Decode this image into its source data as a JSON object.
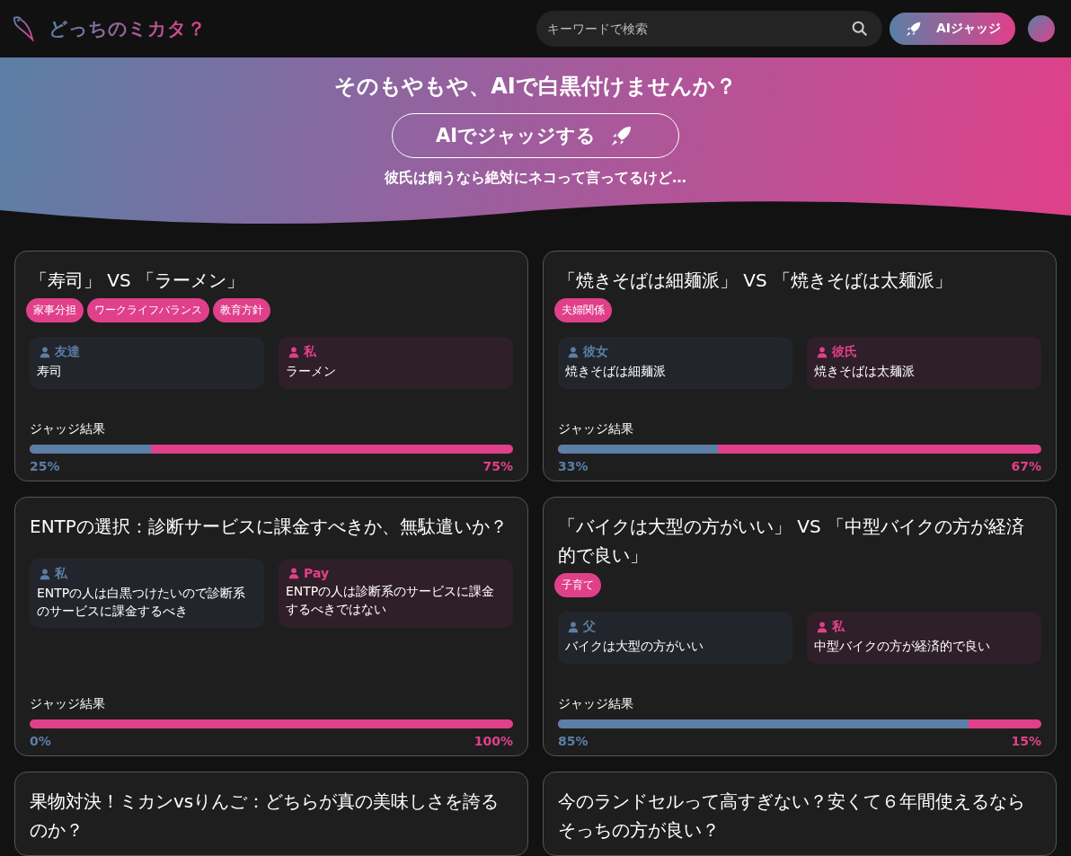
{
  "header": {
    "logo_text": "どっちのミカタ？",
    "search": {
      "placeholder": "キーワードで検索"
    },
    "ai_button": "AIジャッジ"
  },
  "hero": {
    "heading": "そのもやもや、AIで白黒付けませんか？",
    "cta": "AIでジャッジする",
    "example": "彼氏は飼うなら絶対にネコって言ってるけど…"
  },
  "cards": [
    {
      "title": "「寿司」 VS 「ラーメン」",
      "tags": [
        "家事分担",
        "ワークライフバランス",
        "教育方針"
      ],
      "left": {
        "person": "友達",
        "opinion": "寿司"
      },
      "right": {
        "person": "私",
        "opinion": "ラーメン"
      },
      "result_label": "ジャッジ結果",
      "level": 0.25,
      "left_pct": "25%",
      "right_pct": "75%"
    },
    {
      "title": "「焼きそばは細麺派」 VS 「焼きそばは太麺派」",
      "tags": [
        "夫婦関係"
      ],
      "left": {
        "person": "彼女",
        "opinion": "焼きそばは細麺派"
      },
      "right": {
        "person": "彼氏",
        "opinion": "焼きそばは太麺派"
      },
      "result_label": "ジャッジ結果",
      "level": 0.33,
      "left_pct": "33%",
      "right_pct": "67%"
    },
    {
      "title": "ENTPの選択：診断サービスに課金すべきか、無駄遣いか？",
      "left": {
        "person": "私",
        "opinion": "ENTPの人は白黒つけたいので診断系のサービスに課金するべき"
      },
      "right": {
        "person": "Pay",
        "opinion": "ENTPの人は診断系のサービスに課金するべきではない"
      },
      "result_label": "ジャッジ結果",
      "level": 0,
      "left_pct": "0%",
      "right_pct": "100%"
    },
    {
      "title": "「バイクは大型の方がいい」 VS 「中型バイクの方が経済的で良い」",
      "tags": [
        "子育て"
      ],
      "left": {
        "person": "父",
        "opinion": "バイクは大型の方がいい"
      },
      "right": {
        "person": "私",
        "opinion": "中型バイクの方が経済的で良い"
      },
      "result_label": "ジャッジ結果",
      "level": 0.85,
      "left_pct": "85%",
      "right_pct": "15%"
    },
    {
      "title": "果物対決！ミカンvsりんご：どちらが真の美味しさを誇るのか？"
    },
    {
      "title": "今のランドセルって高すぎない？安くて６年間使えるならそっちの方が良い？"
    }
  ]
}
